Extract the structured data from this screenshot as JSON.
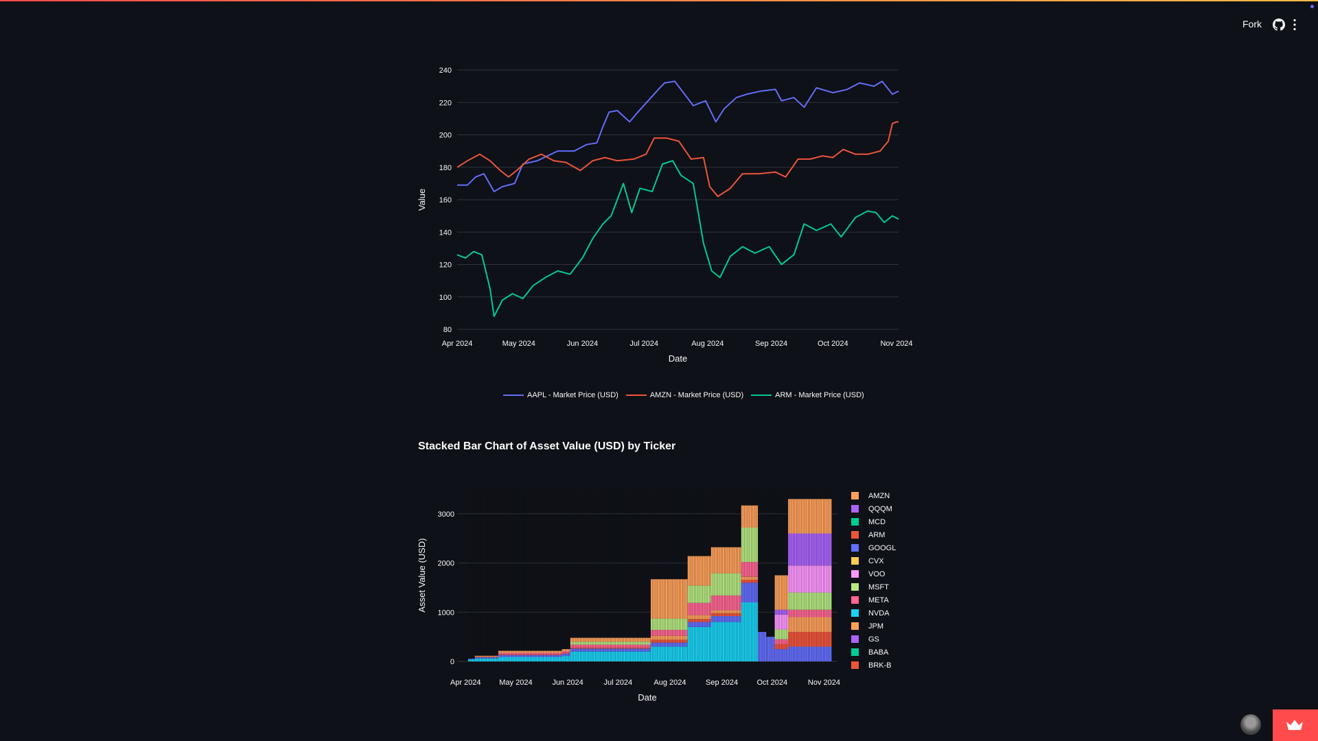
{
  "header": {
    "fork_label": "Fork",
    "icons": [
      "github-icon",
      "more-vert-icon"
    ],
    "status_dot_color": "#6f6af8"
  },
  "chart2_title": "Stacked Bar Chart of Asset Value (USD) by Ticker",
  "footer": {
    "avatar": "avatar",
    "deploy_icon": "crown-icon",
    "deploy_color": "#ff4b4b"
  },
  "chart_data": [
    {
      "type": "line",
      "title": "",
      "xlabel": "Date",
      "ylabel": "Value",
      "x_ticks": [
        "Apr 2024",
        "May 2024",
        "Jun 2024",
        "Jul 2024",
        "Aug 2024",
        "Sep 2024",
        "Oct 2024",
        "Nov 2024"
      ],
      "y_ticks": [
        80,
        100,
        120,
        140,
        160,
        180,
        200,
        220,
        240
      ],
      "ylim": [
        80,
        240
      ],
      "xlim": [
        "2024-04-01",
        "2024-11-02"
      ],
      "grid": true,
      "legend_position": "bottom",
      "series": [
        {
          "name": "AAPL - Market Price (USD)",
          "color": "#636efa",
          "points": [
            [
              "2024-04-01",
              169
            ],
            [
              "2024-04-06",
              169
            ],
            [
              "2024-04-10",
              174
            ],
            [
              "2024-04-14",
              176
            ],
            [
              "2024-04-19",
              165
            ],
            [
              "2024-04-23",
              168
            ],
            [
              "2024-04-29",
              170
            ],
            [
              "2024-05-03",
              182
            ],
            [
              "2024-05-10",
              184
            ],
            [
              "2024-05-15",
              187
            ],
            [
              "2024-05-20",
              190
            ],
            [
              "2024-05-28",
              190
            ],
            [
              "2024-06-03",
              194
            ],
            [
              "2024-06-08",
              195
            ],
            [
              "2024-06-11",
              205
            ],
            [
              "2024-06-14",
              214
            ],
            [
              "2024-06-18",
              215
            ],
            [
              "2024-06-24",
              208
            ],
            [
              "2024-06-28",
              214
            ],
            [
              "2024-07-03",
              221
            ],
            [
              "2024-07-08",
              228
            ],
            [
              "2024-07-11",
              232
            ],
            [
              "2024-07-16",
              233
            ],
            [
              "2024-07-22",
              223
            ],
            [
              "2024-07-25",
              218
            ],
            [
              "2024-07-31",
              221
            ],
            [
              "2024-08-05",
              208
            ],
            [
              "2024-08-09",
              216
            ],
            [
              "2024-08-15",
              223
            ],
            [
              "2024-08-20",
              225
            ],
            [
              "2024-08-27",
              227
            ],
            [
              "2024-09-03",
              228
            ],
            [
              "2024-09-06",
              221
            ],
            [
              "2024-09-12",
              223
            ],
            [
              "2024-09-17",
              217
            ],
            [
              "2024-09-23",
              229
            ],
            [
              "2024-10-01",
              226
            ],
            [
              "2024-10-08",
              228
            ],
            [
              "2024-10-14",
              232
            ],
            [
              "2024-10-21",
              230
            ],
            [
              "2024-10-25",
              233
            ],
            [
              "2024-10-30",
              225
            ],
            [
              "2024-11-02",
              227
            ]
          ]
        },
        {
          "name": "AMZN - Market Price (USD)",
          "color": "#ef553b",
          "points": [
            [
              "2024-04-01",
              180
            ],
            [
              "2024-04-06",
              184
            ],
            [
              "2024-04-12",
              188
            ],
            [
              "2024-04-17",
              184
            ],
            [
              "2024-04-22",
              178
            ],
            [
              "2024-04-26",
              174
            ],
            [
              "2024-04-30",
              178
            ],
            [
              "2024-05-06",
              185
            ],
            [
              "2024-05-12",
              188
            ],
            [
              "2024-05-18",
              184
            ],
            [
              "2024-05-24",
              183
            ],
            [
              "2024-05-31",
              178
            ],
            [
              "2024-06-06",
              184
            ],
            [
              "2024-06-12",
              186
            ],
            [
              "2024-06-18",
              184
            ],
            [
              "2024-06-26",
              185
            ],
            [
              "2024-07-02",
              188
            ],
            [
              "2024-07-06",
              198
            ],
            [
              "2024-07-12",
              198
            ],
            [
              "2024-07-18",
              196
            ],
            [
              "2024-07-24",
              185
            ],
            [
              "2024-07-30",
              186
            ],
            [
              "2024-08-02",
              168
            ],
            [
              "2024-08-06",
              162
            ],
            [
              "2024-08-12",
              167
            ],
            [
              "2024-08-18",
              176
            ],
            [
              "2024-08-26",
              176
            ],
            [
              "2024-09-03",
              177
            ],
            [
              "2024-09-08",
              174
            ],
            [
              "2024-09-14",
              185
            ],
            [
              "2024-09-20",
              185
            ],
            [
              "2024-09-26",
              187
            ],
            [
              "2024-10-01",
              186
            ],
            [
              "2024-10-06",
              191
            ],
            [
              "2024-10-12",
              188
            ],
            [
              "2024-10-18",
              188
            ],
            [
              "2024-10-24",
              190
            ],
            [
              "2024-10-28",
              196
            ],
            [
              "2024-10-30",
              207
            ],
            [
              "2024-11-01",
              208
            ],
            [
              "2024-11-02",
              208
            ]
          ]
        },
        {
          "name": "ARM - Market Price (USD)",
          "color": "#00cc96",
          "points": [
            [
              "2024-04-01",
              126
            ],
            [
              "2024-04-05",
              124
            ],
            [
              "2024-04-09",
              128
            ],
            [
              "2024-04-13",
              126
            ],
            [
              "2024-04-17",
              105
            ],
            [
              "2024-04-19",
              88
            ],
            [
              "2024-04-23",
              98
            ],
            [
              "2024-04-28",
              102
            ],
            [
              "2024-05-03",
              99
            ],
            [
              "2024-05-08",
              107
            ],
            [
              "2024-05-14",
              112
            ],
            [
              "2024-05-20",
              116
            ],
            [
              "2024-05-26",
              114
            ],
            [
              "2024-06-01",
              124
            ],
            [
              "2024-06-06",
              136
            ],
            [
              "2024-06-11",
              145
            ],
            [
              "2024-06-15",
              150
            ],
            [
              "2024-06-21",
              170
            ],
            [
              "2024-06-25",
              152
            ],
            [
              "2024-06-29",
              167
            ],
            [
              "2024-07-05",
              165
            ],
            [
              "2024-07-10",
              182
            ],
            [
              "2024-07-15",
              184
            ],
            [
              "2024-07-19",
              175
            ],
            [
              "2024-07-25",
              170
            ],
            [
              "2024-07-30",
              133
            ],
            [
              "2024-08-03",
              116
            ],
            [
              "2024-08-07",
              112
            ],
            [
              "2024-08-12",
              125
            ],
            [
              "2024-08-18",
              131
            ],
            [
              "2024-08-24",
              127
            ],
            [
              "2024-08-31",
              131
            ],
            [
              "2024-09-06",
              120
            ],
            [
              "2024-09-12",
              126
            ],
            [
              "2024-09-17",
              145
            ],
            [
              "2024-09-23",
              141
            ],
            [
              "2024-09-30",
              145
            ],
            [
              "2024-10-05",
              137
            ],
            [
              "2024-10-12",
              149
            ],
            [
              "2024-10-18",
              153
            ],
            [
              "2024-10-22",
              152
            ],
            [
              "2024-10-26",
              146
            ],
            [
              "2024-10-30",
              150
            ],
            [
              "2024-11-02",
              148
            ]
          ]
        }
      ]
    },
    {
      "type": "bar",
      "stacked": true,
      "title": "Stacked Bar Chart of Asset Value (USD) by Ticker",
      "xlabel": "Date",
      "ylabel": "Asset Value (USD)",
      "x_ticks": [
        "Apr 2024",
        "May 2024",
        "Jun 2024",
        "Jul 2024",
        "Aug 2024",
        "Sep 2024",
        "Oct 2024",
        "Nov 2024"
      ],
      "y_ticks": [
        0,
        1000,
        2000,
        3000
      ],
      "ylim": [
        0,
        3500
      ],
      "xlim": [
        "2024-03-27",
        "2024-11-09"
      ],
      "grid": true,
      "legend_position": "right",
      "legend": [
        {
          "name": "AMZN",
          "color": "#ffa15a"
        },
        {
          "name": "QQQM",
          "color": "#ab63fa"
        },
        {
          "name": "MCD",
          "color": "#00cc96"
        },
        {
          "name": "ARM",
          "color": "#ef553b"
        },
        {
          "name": "GOOGL",
          "color": "#636efa"
        },
        {
          "name": "CVX",
          "color": "#fecb52"
        },
        {
          "name": "VOO",
          "color": "#ff97ff"
        },
        {
          "name": "MSFT",
          "color": "#b6e880"
        },
        {
          "name": "META",
          "color": "#ff6692"
        },
        {
          "name": "NVDA",
          "color": "#19d3f3"
        },
        {
          "name": "JPM",
          "color": "#ffa15a"
        },
        {
          "name": "GS",
          "color": "#ab63fa"
        },
        {
          "name": "BABA",
          "color": "#00cc96"
        },
        {
          "name": "BRK-B",
          "color": "#ef553b"
        }
      ],
      "segment_order": [
        "NVDA",
        "GOOGL",
        "BRK-B",
        "JPM",
        "META",
        "MSFT",
        "VOO",
        "QQQM",
        "AMZN"
      ],
      "periods": [
        {
          "start": "2024-04-03",
          "end": "2024-04-06",
          "values": {
            "NVDA": 40,
            "GOOGL": 15
          }
        },
        {
          "start": "2024-04-07",
          "end": "2024-04-20",
          "values": {
            "NVDA": 60,
            "GOOGL": 25,
            "BRK-B": 10,
            "AMZN": 20
          }
        },
        {
          "start": "2024-04-21",
          "end": "2024-05-28",
          "values": {
            "NVDA": 90,
            "GOOGL": 40,
            "BRK-B": 15,
            "META": 30,
            "AMZN": 40
          }
        },
        {
          "start": "2024-05-29",
          "end": "2024-06-02",
          "values": {
            "NVDA": 110,
            "GOOGL": 50,
            "BRK-B": 15,
            "META": 35,
            "AMZN": 40
          }
        },
        {
          "start": "2024-06-03",
          "end": "2024-07-20",
          "values": {
            "NVDA": 200,
            "GOOGL": 60,
            "BRK-B": 20,
            "META": 60,
            "MSFT": 60,
            "AMZN": 80
          }
        },
        {
          "start": "2024-07-21",
          "end": "2024-08-11",
          "values": {
            "NVDA": 300,
            "GOOGL": 80,
            "BRK-B": 60,
            "JPM": 80,
            "META": 120,
            "MSFT": 230,
            "AMZN": 800
          }
        },
        {
          "start": "2024-08-12",
          "end": "2024-08-25",
          "values": {
            "NVDA": 700,
            "GOOGL": 100,
            "BRK-B": 60,
            "JPM": 80,
            "META": 250,
            "MSFT": 350,
            "AMZN": 600
          }
        },
        {
          "start": "2024-08-26",
          "end": "2024-09-12",
          "values": {
            "NVDA": 800,
            "GOOGL": 120,
            "BRK-B": 60,
            "JPM": 60,
            "META": 300,
            "MSFT": 450,
            "AMZN": 530
          }
        },
        {
          "start": "2024-09-13",
          "end": "2024-09-22",
          "values": {
            "NVDA": 1200,
            "GOOGL": 400,
            "BRK-B": 60,
            "JPM": 60,
            "META": 300,
            "MSFT": 700,
            "AMZN": 450
          }
        },
        {
          "start": "2024-09-23",
          "end": "2024-09-27",
          "values": {
            "GOOGL": 600
          }
        },
        {
          "start": "2024-09-28",
          "end": "2024-10-02",
          "values": {
            "GOOGL": 500
          }
        },
        {
          "start": "2024-10-03",
          "end": "2024-10-10",
          "values": {
            "GOOGL": 250,
            "BRK-B": 100,
            "META": 100,
            "MSFT": 200,
            "VOO": 300,
            "QQQM": 100,
            "AMZN": 700
          }
        },
        {
          "start": "2024-10-11",
          "end": "2024-11-05",
          "values": {
            "GOOGL": 300,
            "BRK-B": 300,
            "JPM": 300,
            "META": 150,
            "MSFT": 350,
            "VOO": 550,
            "QQQM": 650,
            "AMZN": 700
          }
        }
      ]
    }
  ]
}
